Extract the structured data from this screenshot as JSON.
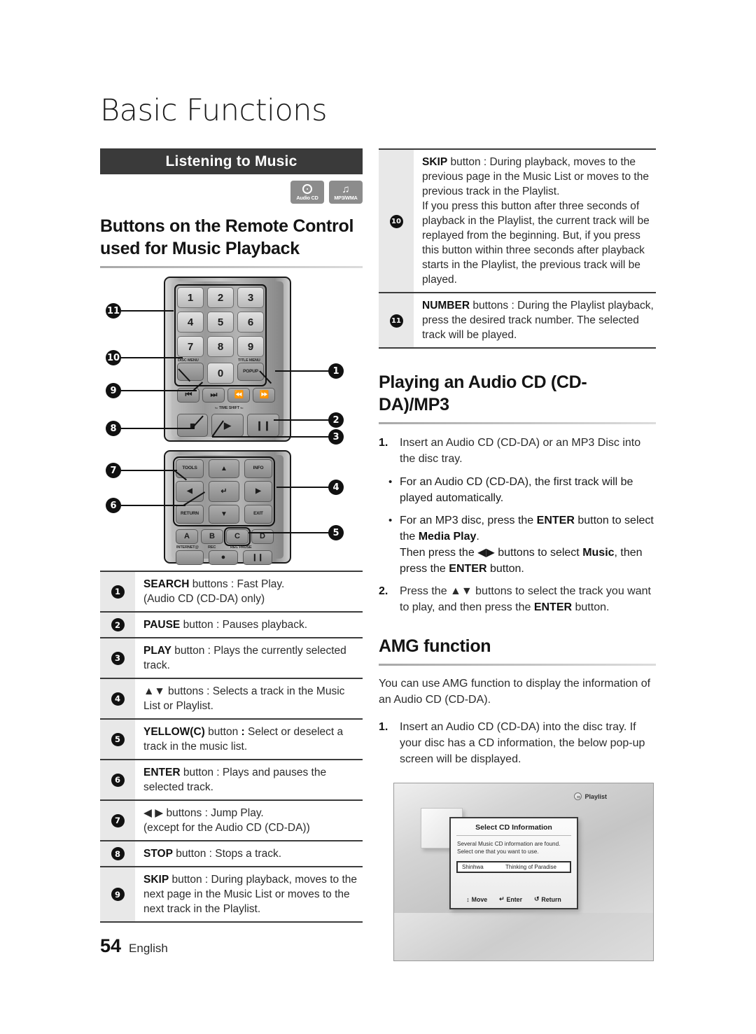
{
  "page": {
    "title": "Basic Functions",
    "number": "54",
    "language": "English"
  },
  "section_banner": {
    "label": "Listening to Music"
  },
  "disc_badges": [
    {
      "icon": "audio-cd-icon",
      "label": "Audio CD",
      "glyph": ""
    },
    {
      "icon": "mp3-wma-icon",
      "label": "MP3/WMA",
      "glyph": "♫"
    }
  ],
  "headings": {
    "remote_buttons": "Buttons on the Remote Control used for Music Playback",
    "playing_cd": "Playing an Audio CD (CD-DA)/MP3",
    "amg": "AMG function"
  },
  "remote": {
    "number_keys": [
      "1",
      "2",
      "3",
      "4",
      "5",
      "6",
      "7",
      "8",
      "9",
      "0"
    ],
    "popup_label": "POPUP",
    "time_shift_label": "TIME SHIFT",
    "tools_label": "TOOLS",
    "info_label": "INFO",
    "return_label": "RETURN",
    "exit_label": "EXIT",
    "color_keys": [
      "A",
      "B",
      "C",
      "D"
    ],
    "internet_label": "INTERNET@",
    "rec_label": "REC",
    "rec_pause_label": "REC PAUSE",
    "callouts_left": [
      "11",
      "10",
      "9",
      "8",
      "7",
      "6"
    ],
    "callouts_right": [
      "1",
      "2",
      "3",
      "4",
      "5"
    ]
  },
  "table_left": [
    {
      "num": "1",
      "html": "<b>SEARCH</b> buttons : Fast Play.<br>(Audio CD (CD-DA) only)"
    },
    {
      "num": "2",
      "html": "<b>PAUSE</b> button : Pauses playback."
    },
    {
      "num": "3",
      "html": "<b>PLAY</b> button : Plays the currently selected track."
    },
    {
      "num": "4",
      "html": "▲▼ buttons : Selects a track in the Music List or Playlist."
    },
    {
      "num": "5",
      "html": "<b>YELLOW(C)</b> button <b>:</b> Select or deselect a track in the music list."
    },
    {
      "num": "6",
      "html": "<b>ENTER</b> button : Plays and pauses the selected track."
    },
    {
      "num": "7",
      "html": "◀ ▶ buttons : Jump Play.<br>(except for the Audio CD (CD-DA))"
    },
    {
      "num": "8",
      "html": "<b>STOP</b> button : Stops a track."
    },
    {
      "num": "9",
      "html": "<b>SKIP</b> button : During playback, moves to the next page in the Music List or moves to the next track in the Playlist."
    }
  ],
  "table_right": [
    {
      "num": "10",
      "html": "<b>SKIP</b> button : During playback, moves to the previous page in the Music List or moves to the previous track in the Playlist.<br>If you press this button after three seconds of playback in the Playlist, the current track will be replayed from the beginning. But, if you press this button within three seconds after playback starts in the Playlist, the previous track will be played."
    },
    {
      "num": "11",
      "html": "<b>NUMBER</b> buttons : During the Playlist playback, press the desired track number. The selected track will be played."
    }
  ],
  "playing_cd_steps": [
    {
      "num": "1.",
      "html": "Insert an Audio CD (CD-DA) or an MP3 Disc into the disc tray.",
      "substeps": [
        "For an Audio CD (CD-DA), the first track will be played automatically.",
        "For an MP3 disc, press the <b class=\"strong\">ENTER</b> button to select the <b class=\"strong\">Media Play</b>.<br>Then press the ◀▶ buttons to select <b class=\"strong\">Music</b>, then press the <b class=\"strong\">ENTER</b> button."
      ]
    },
    {
      "num": "2.",
      "html": "Press the ▲▼ buttons to select the track you want to play, and then press the <b class=\"strong\">ENTER</b> button.",
      "substeps": []
    }
  ],
  "amg": {
    "intro": "You can use AMG function to display the information of an Audio CD (CD-DA).",
    "steps": [
      {
        "num": "1.",
        "html": "Insert an Audio CD (CD-DA) into the disc tray. If your disc has a CD information, the below pop-up screen will be displayed."
      }
    ]
  },
  "tv_screen": {
    "playlist_label": "Playlist",
    "dialog": {
      "title": "Select CD Information",
      "body_line1": "Several Music CD information are found.",
      "body_line2": "Select one that you want to use.",
      "row": {
        "artist": "Shinhwa",
        "album": "Thinking of Paradise"
      },
      "footer": [
        {
          "icon": "updown-arrow-icon",
          "glyph": "↕",
          "label": "Move"
        },
        {
          "icon": "enter-icon",
          "glyph": "↵",
          "label": "Enter"
        },
        {
          "icon": "return-icon",
          "glyph": "↺",
          "label": "Return"
        }
      ]
    }
  },
  "colors": {
    "banner_bg": "#3a3a3a",
    "num_cell_bg": "#e8e8e8",
    "rule": "#3c3c3c",
    "badge_bg": "#8c8c8c"
  }
}
